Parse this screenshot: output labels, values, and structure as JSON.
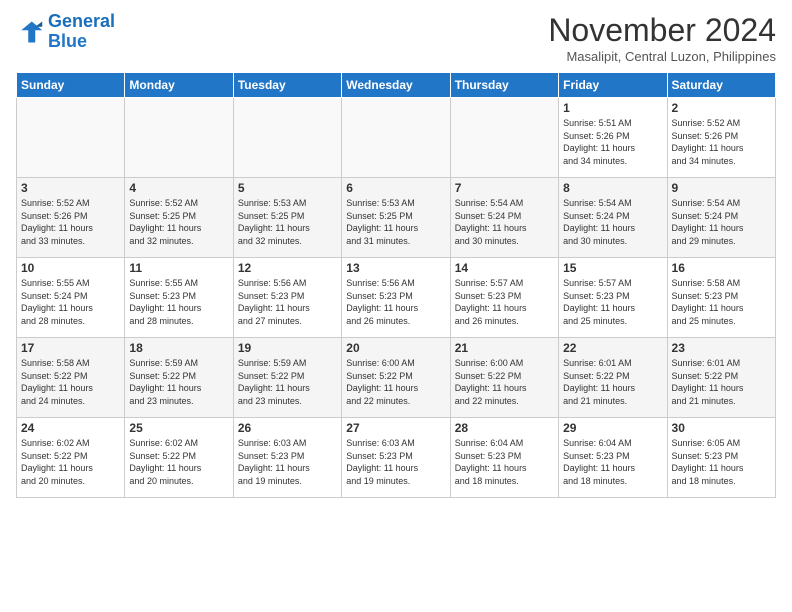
{
  "header": {
    "logo_line1": "General",
    "logo_line2": "Blue",
    "month": "November 2024",
    "location": "Masalipit, Central Luzon, Philippines"
  },
  "weekdays": [
    "Sunday",
    "Monday",
    "Tuesday",
    "Wednesday",
    "Thursday",
    "Friday",
    "Saturday"
  ],
  "weeks": [
    [
      {
        "day": "",
        "info": ""
      },
      {
        "day": "",
        "info": ""
      },
      {
        "day": "",
        "info": ""
      },
      {
        "day": "",
        "info": ""
      },
      {
        "day": "",
        "info": ""
      },
      {
        "day": "1",
        "info": "Sunrise: 5:51 AM\nSunset: 5:26 PM\nDaylight: 11 hours\nand 34 minutes."
      },
      {
        "day": "2",
        "info": "Sunrise: 5:52 AM\nSunset: 5:26 PM\nDaylight: 11 hours\nand 34 minutes."
      }
    ],
    [
      {
        "day": "3",
        "info": "Sunrise: 5:52 AM\nSunset: 5:26 PM\nDaylight: 11 hours\nand 33 minutes."
      },
      {
        "day": "4",
        "info": "Sunrise: 5:52 AM\nSunset: 5:25 PM\nDaylight: 11 hours\nand 32 minutes."
      },
      {
        "day": "5",
        "info": "Sunrise: 5:53 AM\nSunset: 5:25 PM\nDaylight: 11 hours\nand 32 minutes."
      },
      {
        "day": "6",
        "info": "Sunrise: 5:53 AM\nSunset: 5:25 PM\nDaylight: 11 hours\nand 31 minutes."
      },
      {
        "day": "7",
        "info": "Sunrise: 5:54 AM\nSunset: 5:24 PM\nDaylight: 11 hours\nand 30 minutes."
      },
      {
        "day": "8",
        "info": "Sunrise: 5:54 AM\nSunset: 5:24 PM\nDaylight: 11 hours\nand 30 minutes."
      },
      {
        "day": "9",
        "info": "Sunrise: 5:54 AM\nSunset: 5:24 PM\nDaylight: 11 hours\nand 29 minutes."
      }
    ],
    [
      {
        "day": "10",
        "info": "Sunrise: 5:55 AM\nSunset: 5:24 PM\nDaylight: 11 hours\nand 28 minutes."
      },
      {
        "day": "11",
        "info": "Sunrise: 5:55 AM\nSunset: 5:23 PM\nDaylight: 11 hours\nand 28 minutes."
      },
      {
        "day": "12",
        "info": "Sunrise: 5:56 AM\nSunset: 5:23 PM\nDaylight: 11 hours\nand 27 minutes."
      },
      {
        "day": "13",
        "info": "Sunrise: 5:56 AM\nSunset: 5:23 PM\nDaylight: 11 hours\nand 26 minutes."
      },
      {
        "day": "14",
        "info": "Sunrise: 5:57 AM\nSunset: 5:23 PM\nDaylight: 11 hours\nand 26 minutes."
      },
      {
        "day": "15",
        "info": "Sunrise: 5:57 AM\nSunset: 5:23 PM\nDaylight: 11 hours\nand 25 minutes."
      },
      {
        "day": "16",
        "info": "Sunrise: 5:58 AM\nSunset: 5:23 PM\nDaylight: 11 hours\nand 25 minutes."
      }
    ],
    [
      {
        "day": "17",
        "info": "Sunrise: 5:58 AM\nSunset: 5:22 PM\nDaylight: 11 hours\nand 24 minutes."
      },
      {
        "day": "18",
        "info": "Sunrise: 5:59 AM\nSunset: 5:22 PM\nDaylight: 11 hours\nand 23 minutes."
      },
      {
        "day": "19",
        "info": "Sunrise: 5:59 AM\nSunset: 5:22 PM\nDaylight: 11 hours\nand 23 minutes."
      },
      {
        "day": "20",
        "info": "Sunrise: 6:00 AM\nSunset: 5:22 PM\nDaylight: 11 hours\nand 22 minutes."
      },
      {
        "day": "21",
        "info": "Sunrise: 6:00 AM\nSunset: 5:22 PM\nDaylight: 11 hours\nand 22 minutes."
      },
      {
        "day": "22",
        "info": "Sunrise: 6:01 AM\nSunset: 5:22 PM\nDaylight: 11 hours\nand 21 minutes."
      },
      {
        "day": "23",
        "info": "Sunrise: 6:01 AM\nSunset: 5:22 PM\nDaylight: 11 hours\nand 21 minutes."
      }
    ],
    [
      {
        "day": "24",
        "info": "Sunrise: 6:02 AM\nSunset: 5:22 PM\nDaylight: 11 hours\nand 20 minutes."
      },
      {
        "day": "25",
        "info": "Sunrise: 6:02 AM\nSunset: 5:22 PM\nDaylight: 11 hours\nand 20 minutes."
      },
      {
        "day": "26",
        "info": "Sunrise: 6:03 AM\nSunset: 5:23 PM\nDaylight: 11 hours\nand 19 minutes."
      },
      {
        "day": "27",
        "info": "Sunrise: 6:03 AM\nSunset: 5:23 PM\nDaylight: 11 hours\nand 19 minutes."
      },
      {
        "day": "28",
        "info": "Sunrise: 6:04 AM\nSunset: 5:23 PM\nDaylight: 11 hours\nand 18 minutes."
      },
      {
        "day": "29",
        "info": "Sunrise: 6:04 AM\nSunset: 5:23 PM\nDaylight: 11 hours\nand 18 minutes."
      },
      {
        "day": "30",
        "info": "Sunrise: 6:05 AM\nSunset: 5:23 PM\nDaylight: 11 hours\nand 18 minutes."
      }
    ]
  ]
}
